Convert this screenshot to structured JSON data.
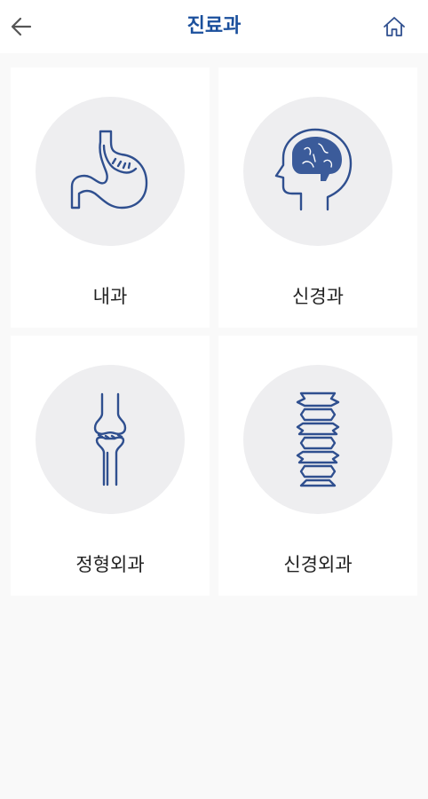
{
  "header": {
    "title": "진료과",
    "back_icon": "arrow-left-icon",
    "home_icon": "home-icon"
  },
  "colors": {
    "accent": "#1a4f9c",
    "icon_stroke": "#2f4f8f",
    "circle_bg": "#eeeef0",
    "page_bg": "#f9f9f9"
  },
  "departments": [
    {
      "label": "내과",
      "icon": "stomach-icon"
    },
    {
      "label": "신경과",
      "icon": "brain-head-icon"
    },
    {
      "label": "정형외과",
      "icon": "knee-bone-icon"
    },
    {
      "label": "신경외과",
      "icon": "spine-icon"
    }
  ]
}
